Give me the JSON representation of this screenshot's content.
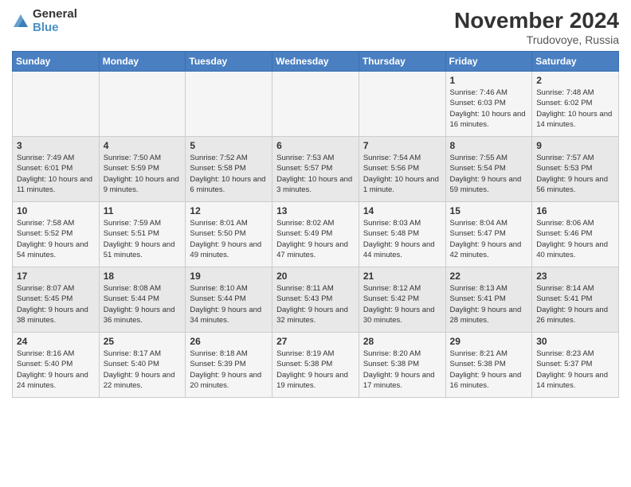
{
  "header": {
    "logo_general": "General",
    "logo_blue": "Blue",
    "title": "November 2024",
    "location": "Trudovoye, Russia"
  },
  "weekdays": [
    "Sunday",
    "Monday",
    "Tuesday",
    "Wednesday",
    "Thursday",
    "Friday",
    "Saturday"
  ],
  "weeks": [
    [
      {
        "day": "",
        "sunrise": "",
        "sunset": "",
        "daylight": ""
      },
      {
        "day": "",
        "sunrise": "",
        "sunset": "",
        "daylight": ""
      },
      {
        "day": "",
        "sunrise": "",
        "sunset": "",
        "daylight": ""
      },
      {
        "day": "",
        "sunrise": "",
        "sunset": "",
        "daylight": ""
      },
      {
        "day": "",
        "sunrise": "",
        "sunset": "",
        "daylight": ""
      },
      {
        "day": "1",
        "sunrise": "Sunrise: 7:46 AM",
        "sunset": "Sunset: 6:03 PM",
        "daylight": "Daylight: 10 hours and 16 minutes."
      },
      {
        "day": "2",
        "sunrise": "Sunrise: 7:48 AM",
        "sunset": "Sunset: 6:02 PM",
        "daylight": "Daylight: 10 hours and 14 minutes."
      }
    ],
    [
      {
        "day": "3",
        "sunrise": "Sunrise: 7:49 AM",
        "sunset": "Sunset: 6:01 PM",
        "daylight": "Daylight: 10 hours and 11 minutes."
      },
      {
        "day": "4",
        "sunrise": "Sunrise: 7:50 AM",
        "sunset": "Sunset: 5:59 PM",
        "daylight": "Daylight: 10 hours and 9 minutes."
      },
      {
        "day": "5",
        "sunrise": "Sunrise: 7:52 AM",
        "sunset": "Sunset: 5:58 PM",
        "daylight": "Daylight: 10 hours and 6 minutes."
      },
      {
        "day": "6",
        "sunrise": "Sunrise: 7:53 AM",
        "sunset": "Sunset: 5:57 PM",
        "daylight": "Daylight: 10 hours and 3 minutes."
      },
      {
        "day": "7",
        "sunrise": "Sunrise: 7:54 AM",
        "sunset": "Sunset: 5:56 PM",
        "daylight": "Daylight: 10 hours and 1 minute."
      },
      {
        "day": "8",
        "sunrise": "Sunrise: 7:55 AM",
        "sunset": "Sunset: 5:54 PM",
        "daylight": "Daylight: 9 hours and 59 minutes."
      },
      {
        "day": "9",
        "sunrise": "Sunrise: 7:57 AM",
        "sunset": "Sunset: 5:53 PM",
        "daylight": "Daylight: 9 hours and 56 minutes."
      }
    ],
    [
      {
        "day": "10",
        "sunrise": "Sunrise: 7:58 AM",
        "sunset": "Sunset: 5:52 PM",
        "daylight": "Daylight: 9 hours and 54 minutes."
      },
      {
        "day": "11",
        "sunrise": "Sunrise: 7:59 AM",
        "sunset": "Sunset: 5:51 PM",
        "daylight": "Daylight: 9 hours and 51 minutes."
      },
      {
        "day": "12",
        "sunrise": "Sunrise: 8:01 AM",
        "sunset": "Sunset: 5:50 PM",
        "daylight": "Daylight: 9 hours and 49 minutes."
      },
      {
        "day": "13",
        "sunrise": "Sunrise: 8:02 AM",
        "sunset": "Sunset: 5:49 PM",
        "daylight": "Daylight: 9 hours and 47 minutes."
      },
      {
        "day": "14",
        "sunrise": "Sunrise: 8:03 AM",
        "sunset": "Sunset: 5:48 PM",
        "daylight": "Daylight: 9 hours and 44 minutes."
      },
      {
        "day": "15",
        "sunrise": "Sunrise: 8:04 AM",
        "sunset": "Sunset: 5:47 PM",
        "daylight": "Daylight: 9 hours and 42 minutes."
      },
      {
        "day": "16",
        "sunrise": "Sunrise: 8:06 AM",
        "sunset": "Sunset: 5:46 PM",
        "daylight": "Daylight: 9 hours and 40 minutes."
      }
    ],
    [
      {
        "day": "17",
        "sunrise": "Sunrise: 8:07 AM",
        "sunset": "Sunset: 5:45 PM",
        "daylight": "Daylight: 9 hours and 38 minutes."
      },
      {
        "day": "18",
        "sunrise": "Sunrise: 8:08 AM",
        "sunset": "Sunset: 5:44 PM",
        "daylight": "Daylight: 9 hours and 36 minutes."
      },
      {
        "day": "19",
        "sunrise": "Sunrise: 8:10 AM",
        "sunset": "Sunset: 5:44 PM",
        "daylight": "Daylight: 9 hours and 34 minutes."
      },
      {
        "day": "20",
        "sunrise": "Sunrise: 8:11 AM",
        "sunset": "Sunset: 5:43 PM",
        "daylight": "Daylight: 9 hours and 32 minutes."
      },
      {
        "day": "21",
        "sunrise": "Sunrise: 8:12 AM",
        "sunset": "Sunset: 5:42 PM",
        "daylight": "Daylight: 9 hours and 30 minutes."
      },
      {
        "day": "22",
        "sunrise": "Sunrise: 8:13 AM",
        "sunset": "Sunset: 5:41 PM",
        "daylight": "Daylight: 9 hours and 28 minutes."
      },
      {
        "day": "23",
        "sunrise": "Sunrise: 8:14 AM",
        "sunset": "Sunset: 5:41 PM",
        "daylight": "Daylight: 9 hours and 26 minutes."
      }
    ],
    [
      {
        "day": "24",
        "sunrise": "Sunrise: 8:16 AM",
        "sunset": "Sunset: 5:40 PM",
        "daylight": "Daylight: 9 hours and 24 minutes."
      },
      {
        "day": "25",
        "sunrise": "Sunrise: 8:17 AM",
        "sunset": "Sunset: 5:40 PM",
        "daylight": "Daylight: 9 hours and 22 minutes."
      },
      {
        "day": "26",
        "sunrise": "Sunrise: 8:18 AM",
        "sunset": "Sunset: 5:39 PM",
        "daylight": "Daylight: 9 hours and 20 minutes."
      },
      {
        "day": "27",
        "sunrise": "Sunrise: 8:19 AM",
        "sunset": "Sunset: 5:38 PM",
        "daylight": "Daylight: 9 hours and 19 minutes."
      },
      {
        "day": "28",
        "sunrise": "Sunrise: 8:20 AM",
        "sunset": "Sunset: 5:38 PM",
        "daylight": "Daylight: 9 hours and 17 minutes."
      },
      {
        "day": "29",
        "sunrise": "Sunrise: 8:21 AM",
        "sunset": "Sunset: 5:38 PM",
        "daylight": "Daylight: 9 hours and 16 minutes."
      },
      {
        "day": "30",
        "sunrise": "Sunrise: 8:23 AM",
        "sunset": "Sunset: 5:37 PM",
        "daylight": "Daylight: 9 hours and 14 minutes."
      }
    ]
  ]
}
